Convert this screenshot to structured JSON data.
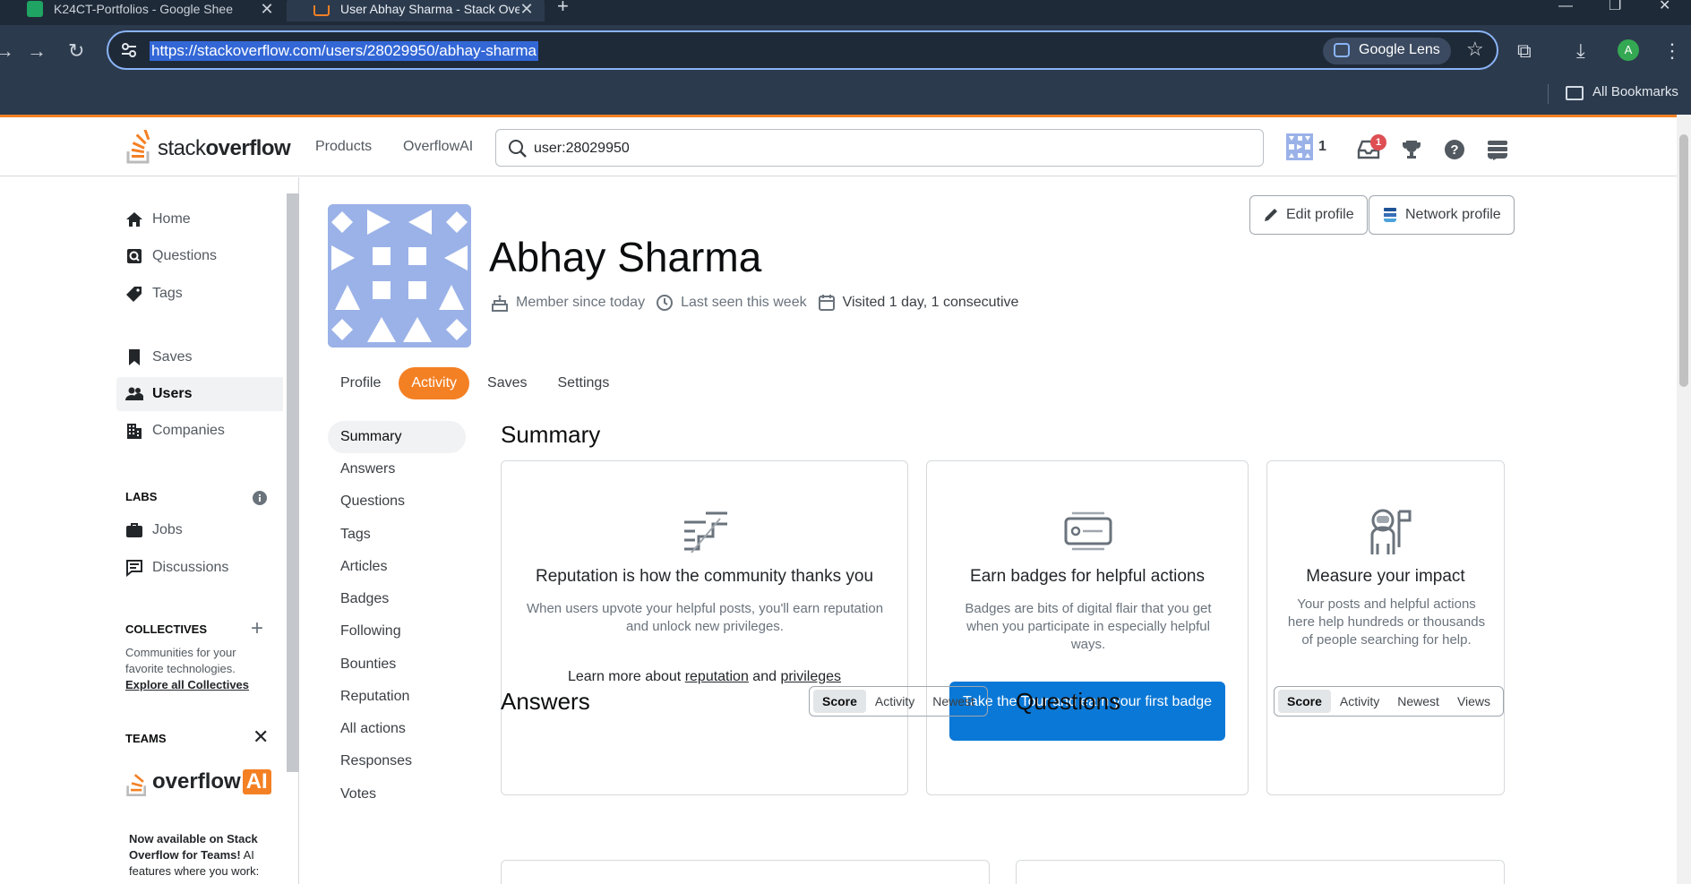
{
  "browser": {
    "tabs": [
      {
        "title": "K24CT-Portfolios - Google Shee",
        "active": false
      },
      {
        "title": "User Abhay Sharma - Stack Ove",
        "active": true
      }
    ],
    "url": "https://stackoverflow.com/users/28029950/abhay-sharma",
    "lens_label": "Google Lens",
    "profile_initial": "A",
    "bookmarks_label": "All Bookmarks"
  },
  "header": {
    "logo_text_light": "stack",
    "logo_text_bold": "overflow",
    "nav": [
      "Products",
      "OverflowAI"
    ],
    "search_value": "user:28029950",
    "reputation": "1",
    "inbox_count": "1"
  },
  "sidebar": {
    "items": [
      {
        "label": "Home",
        "icon": "home-icon"
      },
      {
        "label": "Questions",
        "icon": "questions-icon"
      },
      {
        "label": "Tags",
        "icon": "tag-icon"
      },
      {
        "label": "Saves",
        "icon": "bookmark-icon"
      },
      {
        "label": "Users",
        "icon": "users-icon",
        "active": true
      },
      {
        "label": "Companies",
        "icon": "building-icon"
      }
    ],
    "labs_heading": "LABS",
    "labs_items": [
      {
        "label": "Jobs",
        "icon": "briefcase-icon"
      },
      {
        "label": "Discussions",
        "icon": "chat-icon"
      }
    ],
    "collectives_heading": "COLLECTIVES",
    "collectives_note": "Communities for your favorite technologies.",
    "collectives_link": "Explore all Collectives",
    "teams_heading": "TEAMS",
    "overflowai_text": "overflow",
    "overflowai_ai": "AI",
    "teams_promo_bold": "Now available on Stack Overflow for Teams!",
    "teams_promo_rest": " AI features where you work:"
  },
  "profile": {
    "name": "Abhay Sharma",
    "member_since": "Member since today",
    "last_seen": "Last seen this week",
    "visited": "Visited 1 day, 1 consecutive",
    "edit_label": "Edit profile",
    "network_label": "Network profile",
    "tabs": [
      "Profile",
      "Activity",
      "Saves",
      "Settings"
    ],
    "active_tab": "Activity"
  },
  "activity_nav": [
    "Summary",
    "Answers",
    "Questions",
    "Tags",
    "Articles",
    "Badges",
    "Following",
    "Bounties",
    "Reputation",
    "All actions",
    "Responses",
    "Votes"
  ],
  "summary": {
    "title": "Summary",
    "cards": [
      {
        "title": "Reputation is how the community thanks you",
        "body": "When users upvote your helpful posts, you'll earn reputation and unlock new privileges.",
        "link_prefix": "Learn more about ",
        "link1": "reputation",
        "link_mid": " and ",
        "link2": "privileges"
      },
      {
        "title": "Earn badges for helpful actions",
        "body": "Badges are bits of digital flair that you get when you participate in especially helpful ways.",
        "cta": "Take the Tour and earn your first badge"
      },
      {
        "title": "Measure your impact",
        "body": "Your posts and helpful actions here help hundreds or thousands of people searching for help."
      }
    ]
  },
  "answers": {
    "title": "Answers",
    "sort": [
      "Score",
      "Activity",
      "Newest"
    ],
    "active": "Score"
  },
  "questions": {
    "title": "Questions",
    "sort": [
      "Score",
      "Activity",
      "Newest",
      "Views"
    ],
    "active": "Score"
  },
  "colors": {
    "accent": "#f48024",
    "link_blue": "#0a78d6",
    "badge_red": "#de4f54"
  }
}
